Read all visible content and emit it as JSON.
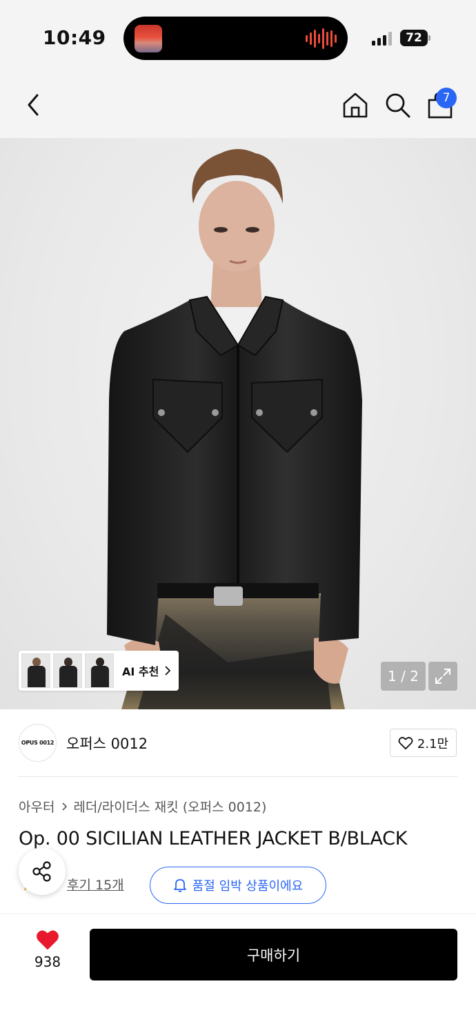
{
  "status_bar": {
    "time": "10:49",
    "battery_percent": "72",
    "battery_level": 0.72
  },
  "nav": {
    "back_icon": "chevron-left-icon",
    "home_icon": "home-icon",
    "search_icon": "search-icon",
    "cart_icon": "shopping-bag-icon",
    "cart_count": "7"
  },
  "gallery": {
    "ai_recommend_label": "AI 추천",
    "page_indicator": "1 / 2",
    "current_page": 1,
    "total_pages": 2,
    "expand_icon": "expand-icon"
  },
  "brand": {
    "logo_text": "OPUS 0012",
    "name": "오퍼스 0012",
    "like_count": "2.1만"
  },
  "breadcrumb": {
    "category": "아우터",
    "subcategory": "레더/라이더스 재킷 (오퍼스 0012)"
  },
  "product": {
    "title": "Op. 00 SICILIAN LEATHER JACKET B/BLACK",
    "review_link": "후기 15개",
    "stock_notice": "품절 임박 상품이에요"
  },
  "bottom_bar": {
    "wish_count": "938",
    "buy_label": "구매하기"
  },
  "colors": {
    "accent_blue": "#2a66f6",
    "heart_red": "#e8192c",
    "button_black": "#000000"
  }
}
